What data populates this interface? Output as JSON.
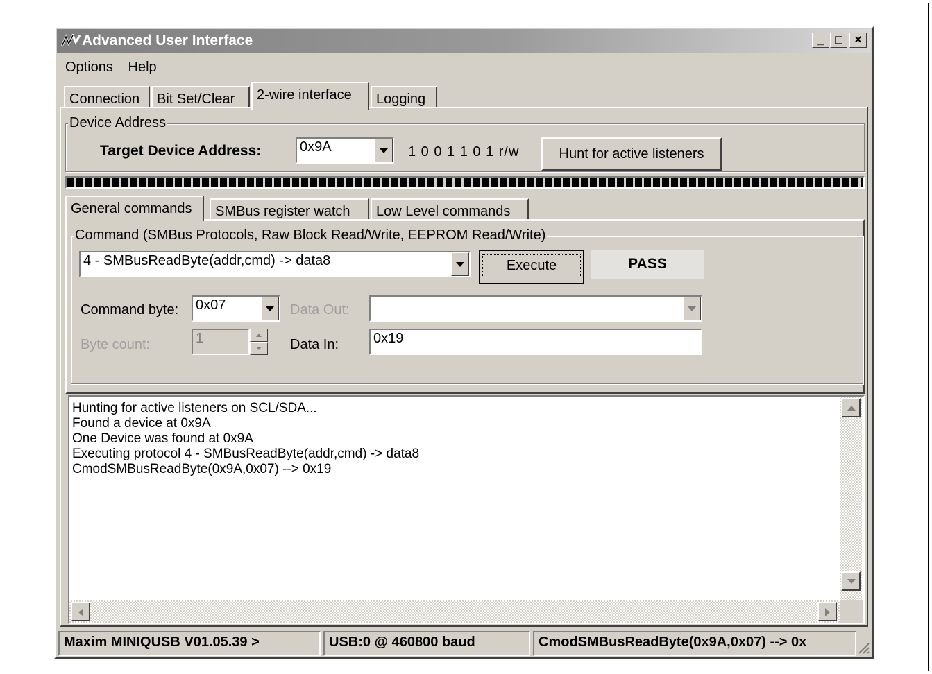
{
  "window": {
    "title": "Advanced User Interface",
    "controls": {
      "minimize": "_",
      "maximize": "□",
      "close": "×"
    }
  },
  "menu": {
    "items": [
      "Options",
      "Help"
    ]
  },
  "main_tabs": [
    "Connection",
    "Bit Set/Clear",
    "2-wire interface",
    "Logging"
  ],
  "main_tabs_active": "2-wire interface",
  "device_address": {
    "group_label": "Device Address",
    "target_label": "Target Device Address:",
    "target_value": "0x9A",
    "bits": "1 0 0 1 1 0 1 r/w",
    "hunt_button": "Hunt for active listeners"
  },
  "sub_tabs": [
    "General commands",
    "SMBus register watch",
    "Low Level commands"
  ],
  "sub_tabs_active": "General commands",
  "command": {
    "group_label": "Command (SMBus Protocols, Raw Block Read/Write, EEPROM Read/Write)",
    "protocol_value": "4 - SMBusReadByte(addr,cmd) -> data8",
    "execute_button": "Execute",
    "result": "PASS",
    "command_byte_label": "Command byte:",
    "command_byte_value": "0x07",
    "data_out_label": "Data Out:",
    "data_out_value": "",
    "byte_count_label": "Byte count:",
    "byte_count_value": "1",
    "data_in_label": "Data In:",
    "data_in_value": "0x19"
  },
  "log_lines": [
    "Hunting for active listeners on SCL/SDA...",
    "Found a device at 0x9A",
    "One Device was found at 0x9A",
    "Executing protocol 4 - SMBusReadByte(addr,cmd) -> data8",
    "CmodSMBusReadByte(0x9A,0x07) --> 0x19"
  ],
  "status_bar": {
    "device": "Maxim MINIQUSB V01.05.39 >",
    "connection": "USB:0 @ 460800 baud",
    "last_command": "CmodSMBusReadByte(0x9A,0x07) --> 0x"
  },
  "colors": {
    "face": "#d4d0c8",
    "title_gradient_start": "#7f7f7f",
    "title_gradient_end": "#d8d8d8"
  }
}
